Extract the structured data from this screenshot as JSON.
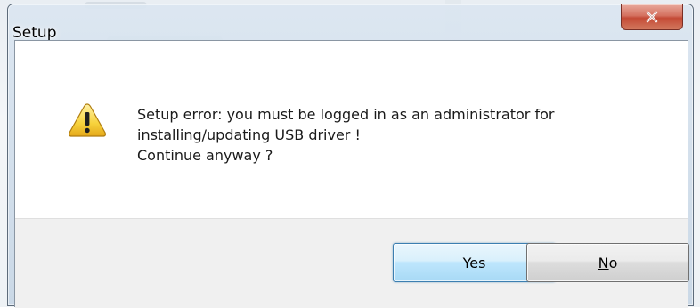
{
  "window": {
    "title": "Setup",
    "close_icon": "close-icon"
  },
  "dialog": {
    "icon": "warning-icon",
    "message_lines": [
      "Setup error: you must be logged in as an administrator for",
      "installing/updating USB driver !",
      "Continue anyway ?"
    ]
  },
  "buttons": {
    "yes_label": "Yes",
    "no_mnemonic": "N",
    "no_rest": "o"
  },
  "colors": {
    "close_button": "#c44a35",
    "default_button_border": "#3c7fb1",
    "button_bar": "#f0f0f0"
  }
}
